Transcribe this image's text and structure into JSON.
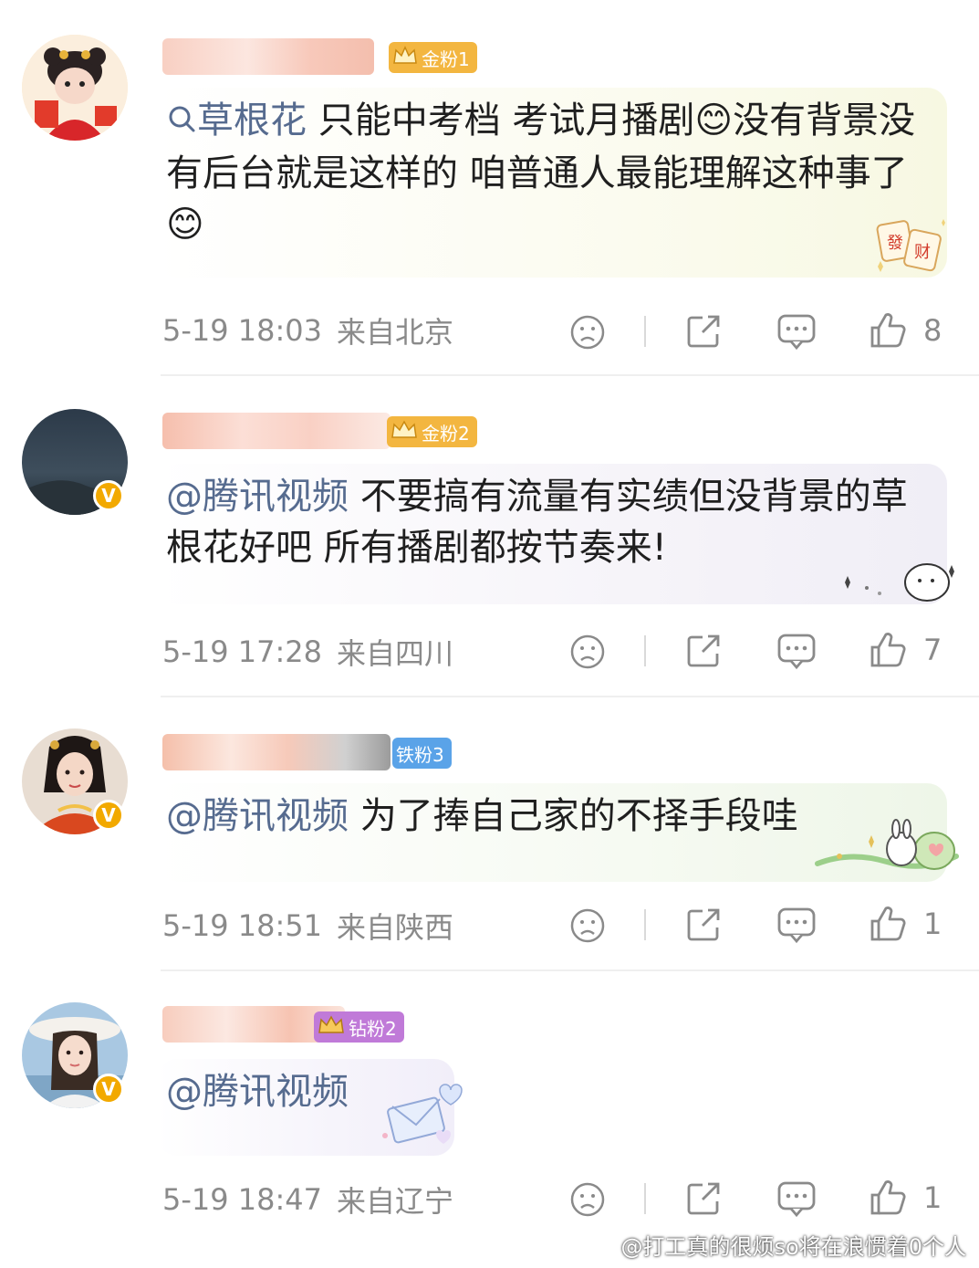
{
  "comments": [
    {
      "fan_badge": "金粉1",
      "search_icon": "search-icon",
      "keyword": "草根花",
      "text": " 只能中考档 考试月播剧😊没有背景没有后台就是这样的 咱普通人最能理解这种事了😊",
      "sticker_text": [
        "發",
        "财"
      ],
      "time": "5-19 18:03",
      "location": "来自北京",
      "likes": "8",
      "badge_color": "#f3b640"
    },
    {
      "fan_badge": "金粉2",
      "mention": "@腾讯视频",
      "text": " 不要搞有流量有实绩但没背景的草根花好吧 所有播剧都按节奏来!",
      "time": "5-19 17:28",
      "location": "来自四川",
      "likes": "7",
      "verified": "V",
      "badge_color": "#f3b640"
    },
    {
      "fan_badge": "铁粉3",
      "mention": "@腾讯视频",
      "text": " 为了捧自己家的不择手段哇",
      "time": "5-19 18:51",
      "location": "来自陕西",
      "likes": "1",
      "verified": "V",
      "badge_color": "#5aa3e8"
    },
    {
      "fan_badge": "钻粉2",
      "mention": "@腾讯视频",
      "text": "",
      "time": "5-19 18:47",
      "location": "来自辽宁",
      "likes": "1",
      "verified": "V",
      "badge_color": "#c07ad8"
    }
  ],
  "watermark": "@打工真的很烦so将在浪惯着0个人"
}
